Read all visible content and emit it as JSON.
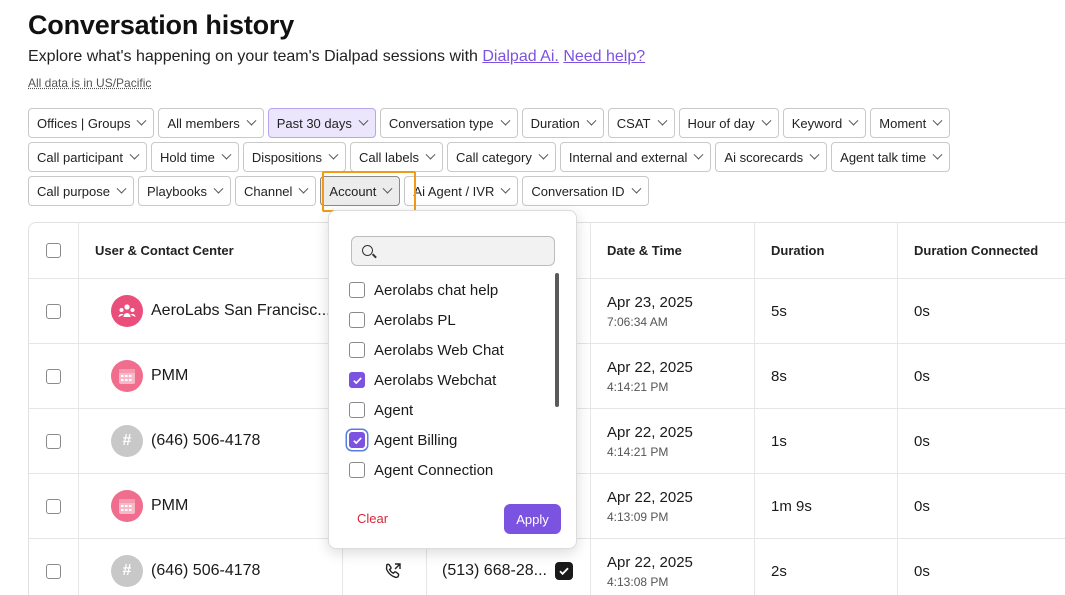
{
  "header": {
    "title": "Conversation history",
    "subtitle_text": "Explore what's happening on your team's Dialpad sessions with ",
    "link_ai": "Dialpad Ai.",
    "link_help": "Need help?",
    "timezone_note": "All data is in US/Pacific"
  },
  "filters": {
    "row1": [
      "Offices | Groups",
      "All members",
      "Past 30 days",
      "Conversation type",
      "Duration",
      "CSAT",
      "Hour of day",
      "Keyword",
      "Moment"
    ],
    "row2": [
      "Call participant",
      "Hold time",
      "Dispositions",
      "Call labels",
      "Call category",
      "Internal and external",
      "Ai scorecards",
      "Agent talk time"
    ],
    "row3": [
      "Call purpose",
      "Playbooks",
      "Channel",
      "Account",
      "Ai Agent / IVR",
      "Conversation ID"
    ],
    "active": "Past 30 days",
    "open": "Account"
  },
  "table": {
    "headers": {
      "user": "User & Contact Center",
      "datetime": "Date & Time",
      "duration": "Duration",
      "duration_connected": "Duration Connected"
    },
    "rows": [
      {
        "name": "AeroLabs San Francisc...",
        "avatar": "group-icon",
        "date": "Apr 23, 2025",
        "time": "7:06:34 AM",
        "duration": "5s",
        "connected": "0s"
      },
      {
        "name": "PMM",
        "avatar": "calendar-icon",
        "date": "Apr 22, 2025",
        "time": "4:14:21 PM",
        "duration": "8s",
        "connected": "0s"
      },
      {
        "name": "(646) 506-4178",
        "avatar": "hash-icon",
        "date": "Apr 22, 2025",
        "time": "4:14:21 PM",
        "duration": "1s",
        "connected": "0s"
      },
      {
        "name": "PMM",
        "avatar": "calendar-icon",
        "date": "Apr 22, 2025",
        "time": "4:13:09 PM",
        "duration": "1m 9s",
        "connected": "0s"
      },
      {
        "name": "(646) 506-4178",
        "avatar": "hash-icon",
        "date": "Apr 22, 2025",
        "time": "4:13:08 PM",
        "duration": "2s",
        "connected": "0s"
      }
    ],
    "last_row_phone": "(513) 668-28..."
  },
  "account_dropdown": {
    "search_placeholder": "",
    "options": [
      {
        "label": "Aerolabs chat help",
        "checked": false
      },
      {
        "label": "Aerolabs PL",
        "checked": false
      },
      {
        "label": "Aerolabs Web Chat",
        "checked": false
      },
      {
        "label": "Aerolabs Webchat",
        "checked": true
      },
      {
        "label": "Agent",
        "checked": false
      },
      {
        "label": "Agent Billing",
        "checked": true
      },
      {
        "label": "Agent Connection",
        "checked": false
      }
    ],
    "clear_label": "Clear",
    "apply_label": "Apply"
  },
  "colors": {
    "accent": "#7c52e0",
    "highlight": "#f29a16",
    "clear": "#d6283b"
  }
}
